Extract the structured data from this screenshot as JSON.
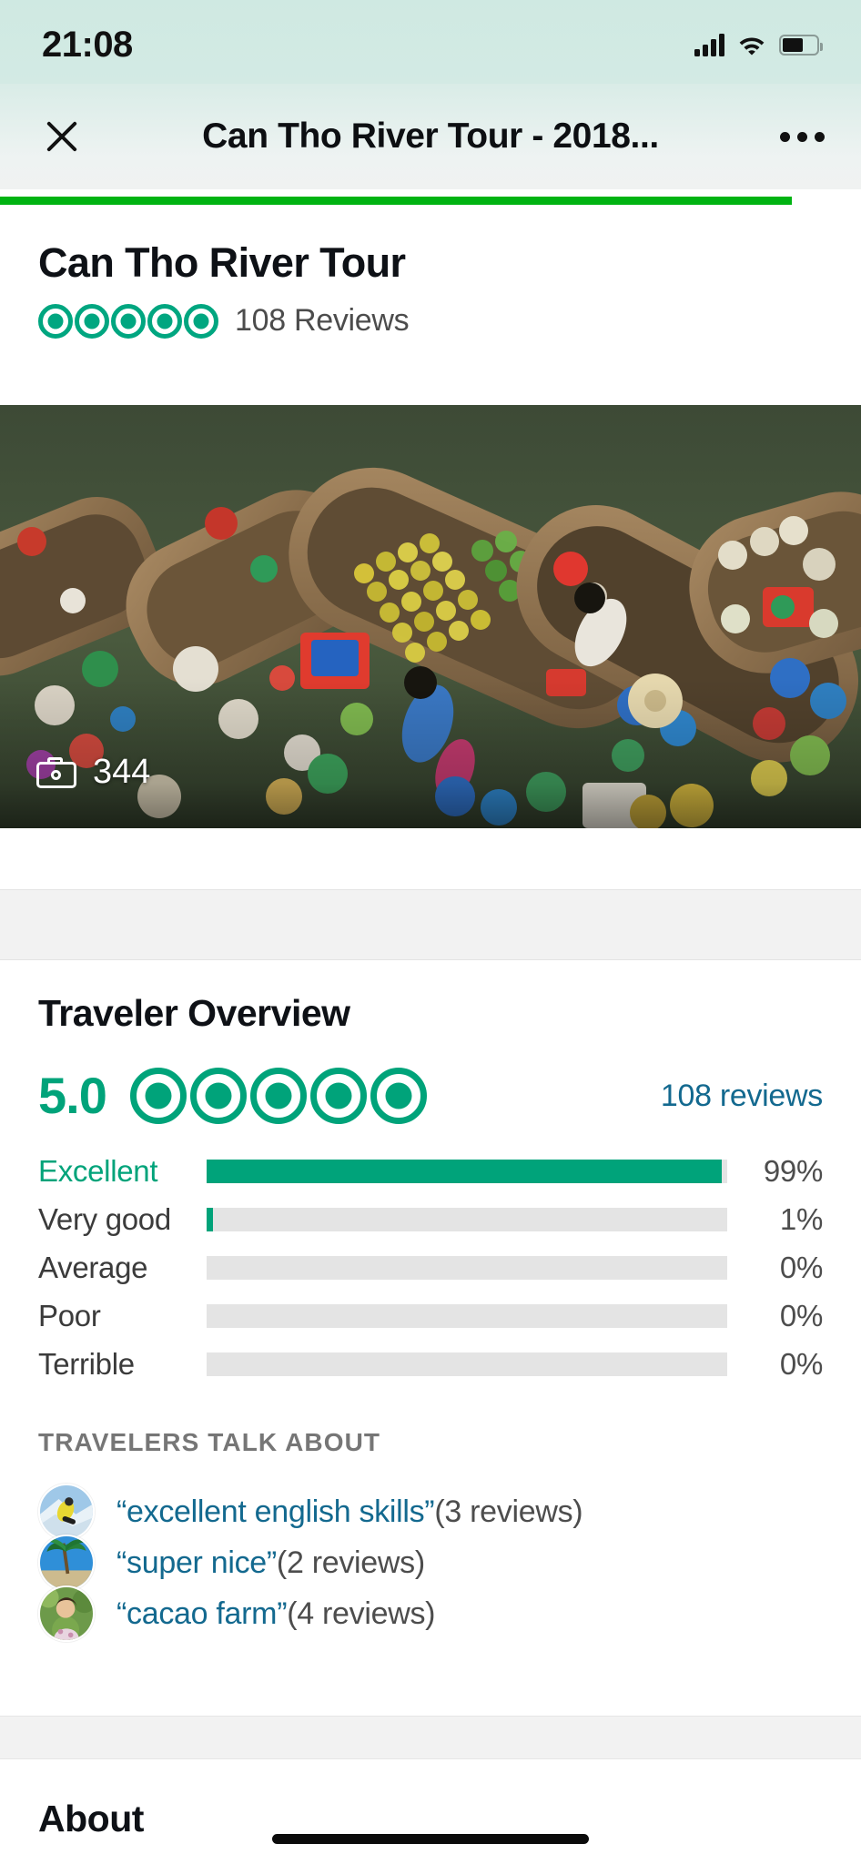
{
  "statusbar": {
    "time": "21:08",
    "signal_icon": "cellular-signal-icon",
    "wifi_icon": "wifi-icon",
    "battery_icon": "battery-icon",
    "battery_level_pct": 60
  },
  "navbar": {
    "close_icon": "close-icon",
    "title": "Can Tho River Tour - 2018...",
    "more_icon": "more-options-icon"
  },
  "progress": {
    "fill_pct": 92,
    "color": "#00b312"
  },
  "title_block": {
    "poi_title": "Can Tho River Tour",
    "bubble_rating": 5,
    "review_count": "108 Reviews"
  },
  "hero": {
    "photo_badge_icon": "camera-icon",
    "photo_count": "344",
    "alt": "Floating market boats loaded with fruit on a river"
  },
  "overview": {
    "section_title": "Traveler Overview",
    "score": "5.0",
    "bubble_rating": 5,
    "reviews_link": "108 reviews",
    "accent_color": "#00a37a",
    "link_color": "#13698f"
  },
  "chart_data": {
    "type": "bar",
    "title": "Traveler Overview",
    "categories": [
      "Excellent",
      "Very good",
      "Average",
      "Poor",
      "Terrible"
    ],
    "values": [
      99,
      1,
      0,
      0,
      0
    ],
    "labels": [
      "99%",
      "1%",
      "0%",
      "0%",
      "0%"
    ],
    "xlabel": "",
    "ylabel": "",
    "xlim": [
      0,
      100
    ],
    "grid": false,
    "orientation": "horizontal",
    "bar_color": "#00a37a",
    "track_color": "#e4e4e4"
  },
  "travelers_talk_about": {
    "heading": "TRAVELERS TALK ABOUT",
    "items": [
      {
        "quote": "“excellent english skills”",
        "count": "(3 reviews)",
        "avatar": "skier-thumbnail"
      },
      {
        "quote": "“super nice”",
        "count": "(2 reviews)",
        "avatar": "palm-tree-thumbnail"
      },
      {
        "quote": "“cacao farm”",
        "count": "(4 reviews)",
        "avatar": "woman-garden-thumbnail"
      }
    ]
  },
  "about": {
    "title": "About"
  }
}
